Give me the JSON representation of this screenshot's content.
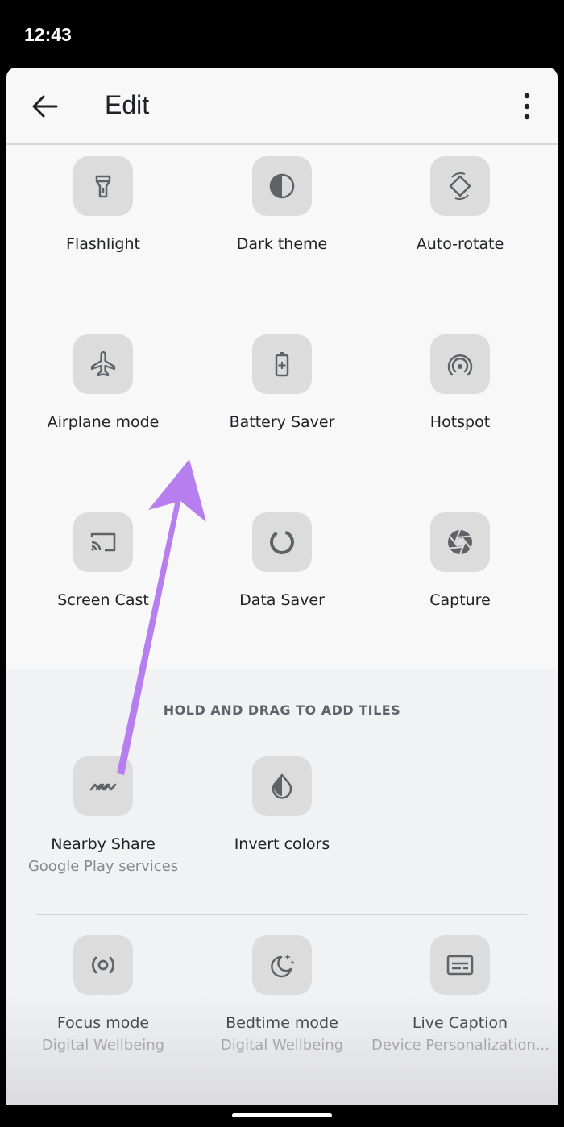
{
  "status_bar": {
    "time": "12:43"
  },
  "app_bar": {
    "title": "Edit"
  },
  "current_tiles": [
    {
      "label": "Flashlight",
      "icon": "flashlight-icon"
    },
    {
      "label": "Dark theme",
      "icon": "dark-theme-icon"
    },
    {
      "label": "Auto-rotate",
      "icon": "auto-rotate-icon"
    },
    {
      "label": "Airplane mode",
      "icon": "airplane-icon"
    },
    {
      "label": "Battery Saver",
      "icon": "battery-saver-icon"
    },
    {
      "label": "Hotspot",
      "icon": "hotspot-icon"
    },
    {
      "label": "Screen Cast",
      "icon": "screen-cast-icon"
    },
    {
      "label": "Data Saver",
      "icon": "data-saver-icon"
    },
    {
      "label": "Capture",
      "icon": "capture-icon"
    }
  ],
  "add_section": {
    "header": "HOLD AND DRAG TO ADD TILES",
    "tiles": [
      {
        "label": "Nearby Share",
        "sub": "Google Play services",
        "icon": "nearby-share-icon"
      },
      {
        "label": "Invert colors",
        "sub": "",
        "icon": "invert-colors-icon"
      },
      {
        "label": "Focus mode",
        "sub": "Digital Wellbeing",
        "icon": "focus-mode-icon"
      },
      {
        "label": "Bedtime mode",
        "sub": "Digital Wellbeing",
        "icon": "bedtime-mode-icon"
      },
      {
        "label": "Live Caption",
        "sub": "Device Personalization...",
        "icon": "live-caption-icon"
      }
    ]
  },
  "colors": {
    "icon_color": "#5f6368",
    "tile_bg": "#dcdcdc",
    "annotation_arrow": "#b77ef0"
  }
}
